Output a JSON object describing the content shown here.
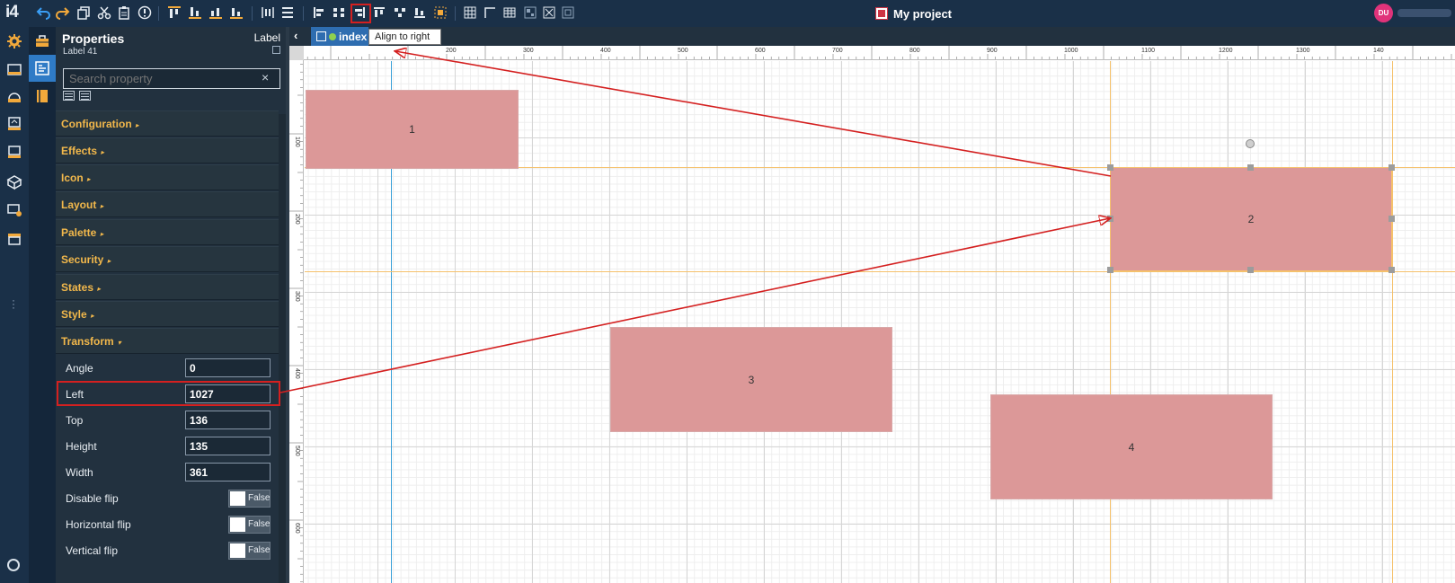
{
  "toolbar": {
    "logo": "i4",
    "icons": [
      "undo-icon",
      "redo-icon",
      "copy-icon",
      "cut-icon",
      "paste-icon",
      "info-icon",
      "align-top-icon",
      "align-bottom-icon",
      "align-middle-icon",
      "align-baseline-icon",
      "distribute-horizontal-icon",
      "distribute-vertical-icon",
      "align-left-icon",
      "align-center-icon",
      "align-right-icon",
      "align-top-edge-icon",
      "align-middle-vertical-icon",
      "align-bottom-edge-icon",
      "group-icon",
      "grid-icon",
      "snap-icon",
      "table-icon",
      "layout-icon",
      "lock-icon",
      "frame-icon"
    ],
    "project_title": "My project",
    "avatar_initials": "DU",
    "tooltip": "Align to right"
  },
  "properties": {
    "title": "Properties",
    "type": "Label",
    "subtitle": "Label 41",
    "search_placeholder": "Search property",
    "search_clear": "×",
    "sections": [
      {
        "label": "Configuration",
        "caret": "▸"
      },
      {
        "label": "Effects",
        "caret": "▸"
      },
      {
        "label": "Icon",
        "caret": "▸"
      },
      {
        "label": "Layout",
        "caret": "▸"
      },
      {
        "label": "Palette",
        "caret": "▸"
      },
      {
        "label": "Security",
        "caret": "▸"
      },
      {
        "label": "States",
        "caret": "▸"
      },
      {
        "label": "Style",
        "caret": "▸"
      },
      {
        "label": "Transform",
        "caret": "▾"
      }
    ],
    "transform_fields": [
      {
        "label": "Angle",
        "value": "0"
      },
      {
        "label": "Left",
        "value": "1027"
      },
      {
        "label": "Top",
        "value": "136"
      },
      {
        "label": "Height",
        "value": "135"
      },
      {
        "label": "Width",
        "value": "361"
      }
    ],
    "toggles": [
      {
        "label": "Disable flip",
        "value": "False"
      },
      {
        "label": "Horizontal flip",
        "value": "False"
      },
      {
        "label": "Vertical flip",
        "value": "False"
      }
    ]
  },
  "tab": {
    "back": "‹",
    "label": "index"
  },
  "ruler": {
    "top_labels": [
      "200",
      "300",
      "400",
      "500",
      "600",
      "700",
      "800",
      "900",
      "1000",
      "1100",
      "1200",
      "1300",
      "140"
    ],
    "left_labels": [
      "100",
      "200",
      "300",
      "400",
      "500",
      "600"
    ]
  },
  "shapes": [
    {
      "label": "1"
    },
    {
      "label": "2"
    },
    {
      "label": "3"
    },
    {
      "label": "4"
    }
  ],
  "colors": {
    "toolbar_bg": "#1a3048",
    "panel_bg": "#22313f",
    "section_text": "#f2b84b",
    "shape_fill": "#dc9898",
    "annotation_red": "#d42020",
    "guide_orange": "#f5c16b",
    "guide_blue": "#3aa0d8"
  }
}
